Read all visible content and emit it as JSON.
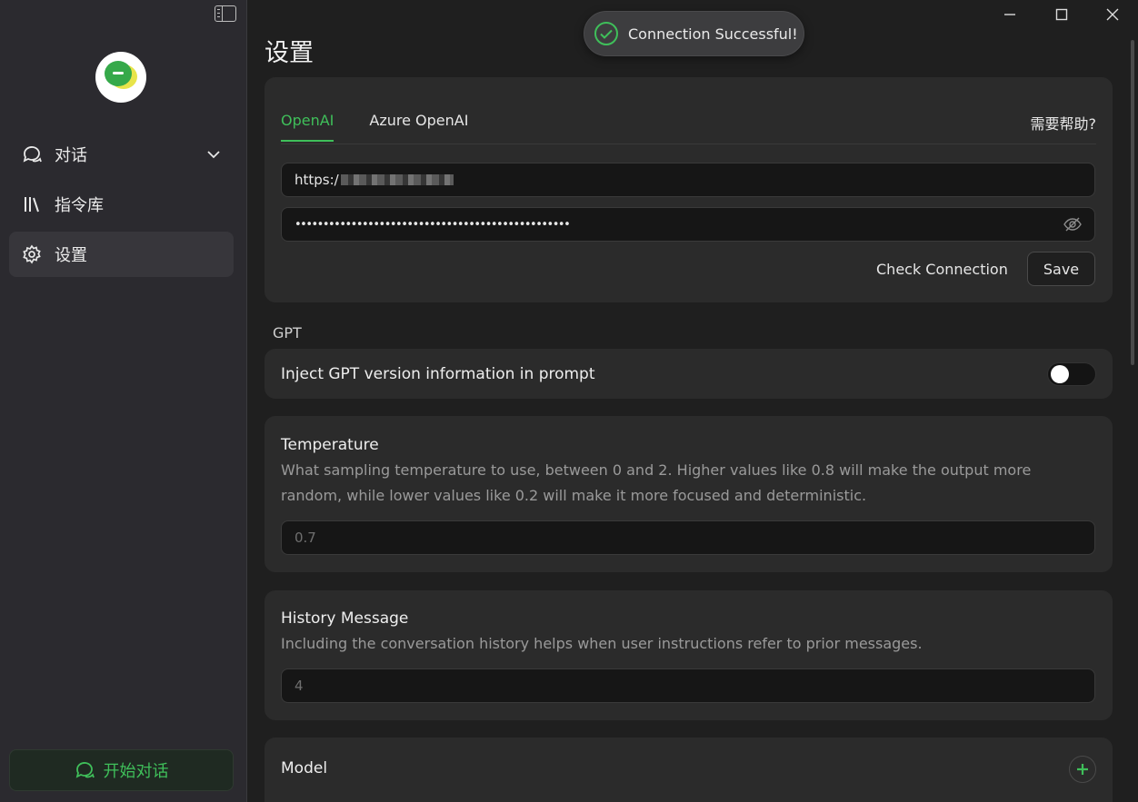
{
  "sidebar": {
    "items": [
      {
        "label": "对话",
        "icon": "chat-bubble-icon"
      },
      {
        "label": "指令库",
        "icon": "library-icon"
      },
      {
        "label": "设置",
        "icon": "gear-icon"
      }
    ],
    "start_button": "开始对话"
  },
  "toast": {
    "message": "Connection Successful!"
  },
  "page": {
    "title": "设置"
  },
  "api": {
    "tabs": [
      "OpenAI",
      "Azure OpenAI"
    ],
    "active_tab": "OpenAI",
    "help": "需要帮助?",
    "url_value": "https:/",
    "key_value": "•••••••••••••••••••••••••••••••••••••••••••••••••",
    "check_button": "Check Connection",
    "save_button": "Save"
  },
  "gpt": {
    "section_label": "GPT",
    "inject_label": "Inject GPT version information in prompt",
    "inject_enabled": false
  },
  "temperature": {
    "title": "Temperature",
    "description": "What sampling temperature to use, between 0 and 2. Higher values like 0.8 will make the output more random, while lower values like 0.2 will make it more focused and deterministic.",
    "placeholder": "0.7"
  },
  "history": {
    "title": "History Message",
    "description": "Including the conversation history helps when user instructions refer to prior messages.",
    "placeholder": "4"
  },
  "model": {
    "title": "Model"
  },
  "colors": {
    "accent": "#3fbf5a",
    "background": "#1f1f1f",
    "sidebar": "#2b2a2f",
    "card": "#2b2b2b"
  }
}
